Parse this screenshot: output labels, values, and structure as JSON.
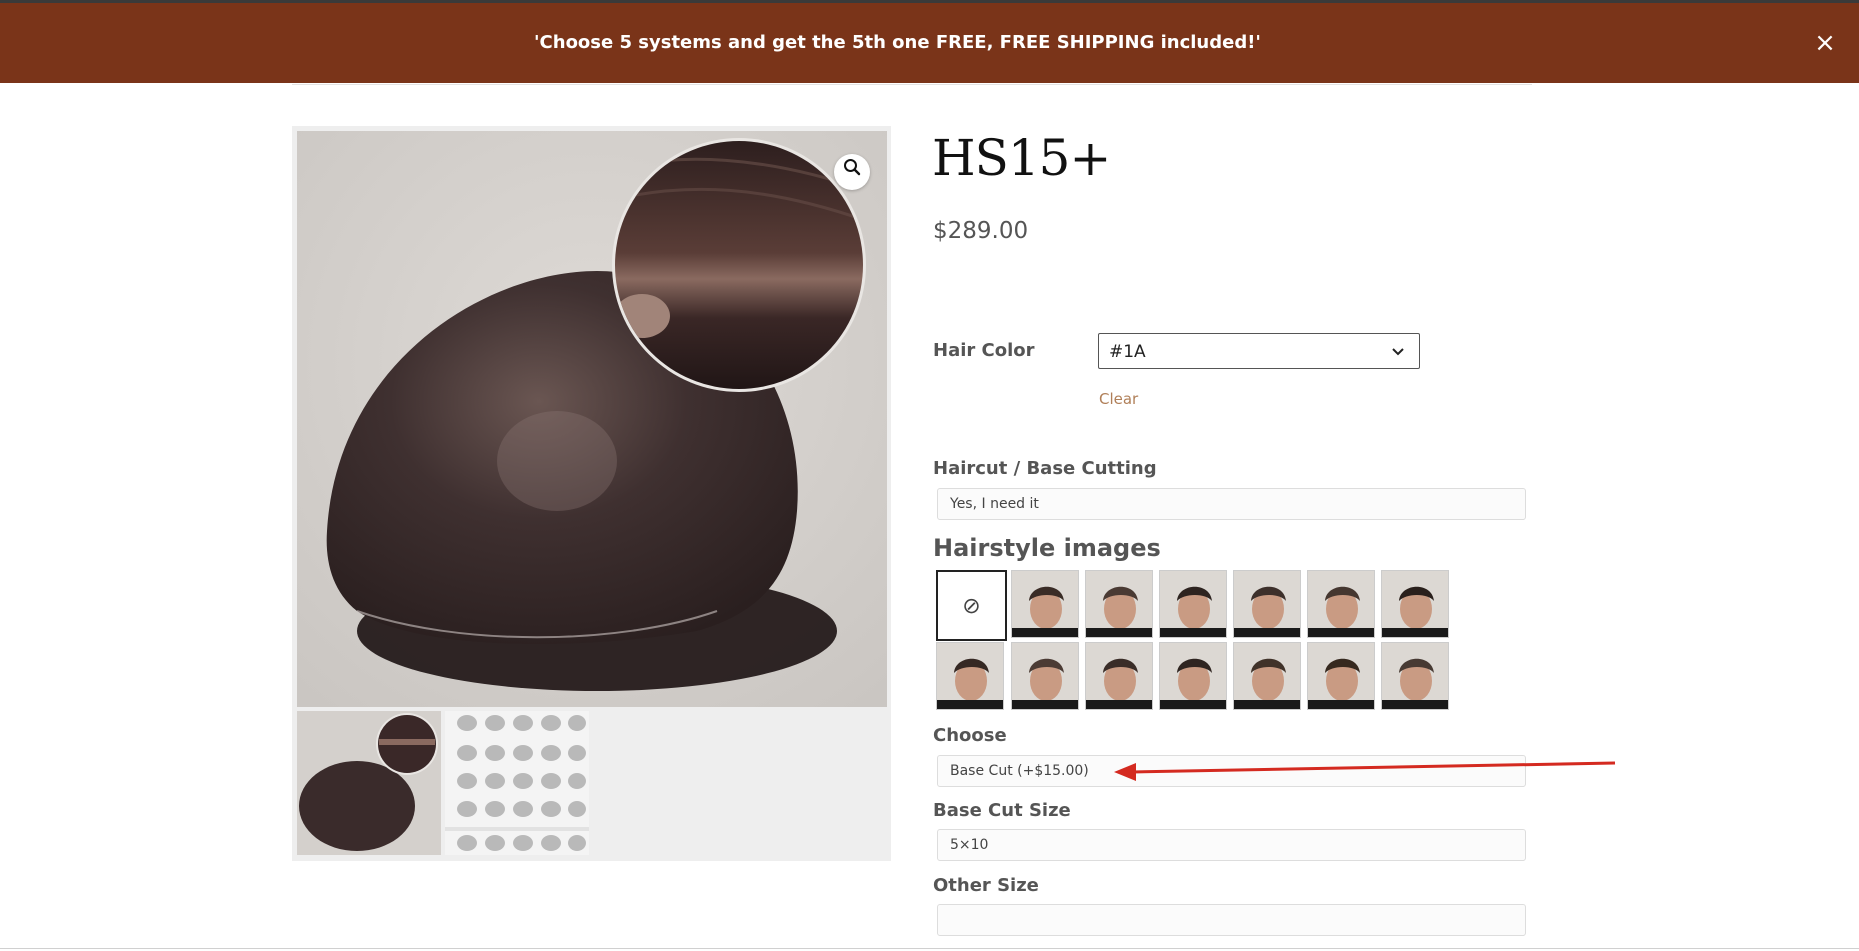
{
  "banner": {
    "text": "'Choose 5 systems and get the 5th one FREE, FREE SHIPPING included!'",
    "close_icon": "×"
  },
  "product": {
    "title": "HS15+",
    "price": "$289.00"
  },
  "hair_color": {
    "label": "Hair Color",
    "value": "#1A",
    "clear": "Clear"
  },
  "haircut": {
    "label": "Haircut / Base Cutting",
    "value": "Yes, I need it"
  },
  "hairstyle": {
    "heading": "Hairstyle images",
    "none_icon": "⊘",
    "swatch_count": 14
  },
  "choose": {
    "label": "Choose",
    "value": "Base Cut (+$15.00)"
  },
  "base_cut_size": {
    "label": "Base Cut Size",
    "value": "5×10"
  },
  "other_size": {
    "label": "Other Size",
    "value": ""
  },
  "colors": {
    "banner": "#7a3419",
    "accent_link": "#b07f58",
    "annotation_arrow": "#d42a20"
  }
}
